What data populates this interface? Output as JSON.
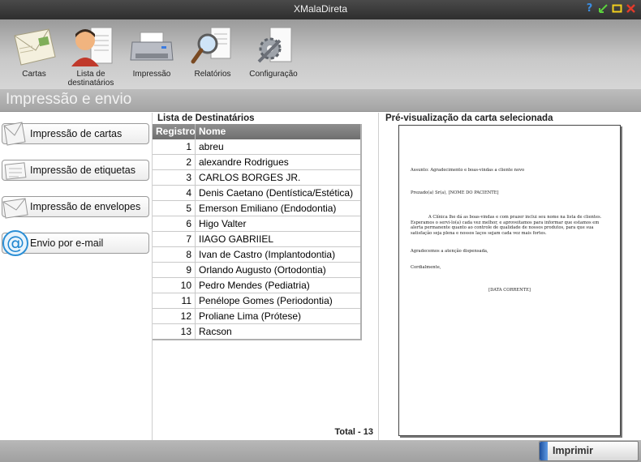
{
  "window": {
    "title": "XMalaDireta"
  },
  "toolbar": {
    "items": [
      {
        "label": "Cartas",
        "icon": "envelope-icon"
      },
      {
        "label": "Lista de destinatários",
        "icon": "contacts-icon"
      },
      {
        "label": "Impressão",
        "icon": "printer-icon"
      },
      {
        "label": "Relatórios",
        "icon": "report-search-icon"
      },
      {
        "label": "Configuração",
        "icon": "settings-icon"
      }
    ]
  },
  "section": {
    "title": "Impressão e envio"
  },
  "left_menu": {
    "items": [
      {
        "label": "Impressão de cartas",
        "icon": "letter-icon"
      },
      {
        "label": "Impressão de etiquetas",
        "icon": "label-icon"
      },
      {
        "label": "Impressão de envelopes",
        "icon": "envelope-small-icon"
      },
      {
        "label": "Envio por e-mail",
        "icon": "email-at-icon"
      }
    ]
  },
  "recipients": {
    "title": "Lista de Destinatários",
    "columns": [
      "Registro",
      "Nome"
    ],
    "rows": [
      {
        "id": "1",
        "name": "abreu"
      },
      {
        "id": "2",
        "name": "alexandre Rodrigues"
      },
      {
        "id": "3",
        "name": "CARLOS BORGES JR."
      },
      {
        "id": "4",
        "name": "Denis Caetano (Dentística/Estética)"
      },
      {
        "id": "5",
        "name": "Emerson Emiliano (Endodontia)"
      },
      {
        "id": "6",
        "name": "Higo Valter"
      },
      {
        "id": "7",
        "name": "IIAGO GABRIIEL"
      },
      {
        "id": "8",
        "name": "Ivan de Castro (Implantodontia)"
      },
      {
        "id": "9",
        "name": "Orlando Augusto (Ortodontia)"
      },
      {
        "id": "10",
        "name": "Pedro Mendes (Pediatria)"
      },
      {
        "id": "11",
        "name": "Penélope Gomes (Periodontia)"
      },
      {
        "id": "12",
        "name": "Proliane Lima (Prótese)"
      },
      {
        "id": "13",
        "name": "Racson"
      }
    ],
    "total": "Total - 13"
  },
  "preview": {
    "title": "Pré-visualização da carta selecionada",
    "subject": "Assunto: Agradecimento e boas-vindas a cliente novo",
    "greeting": "Prezado(a) Sr(a), [NOME DO PACIENTE]",
    "body": "A Clínica lhe dá as boas-vindas e com prazer inclui seu nome na lista de clientes. Esperamos o servi-lo(a) cada vez melhor, e aproveitamos para informar que estamos em alerta permanente quanto ao controle de qualidade de nossos produtos, para que sua satisfação seja plena e nossos laços sejam cada vez mais fortes.",
    "thanks": "Agradecemos a atenção dispensada,",
    "closing": "Cordialmente,",
    "date": "[DATA CORRENTE]"
  },
  "footer": {
    "print_label": "Imprimir"
  }
}
